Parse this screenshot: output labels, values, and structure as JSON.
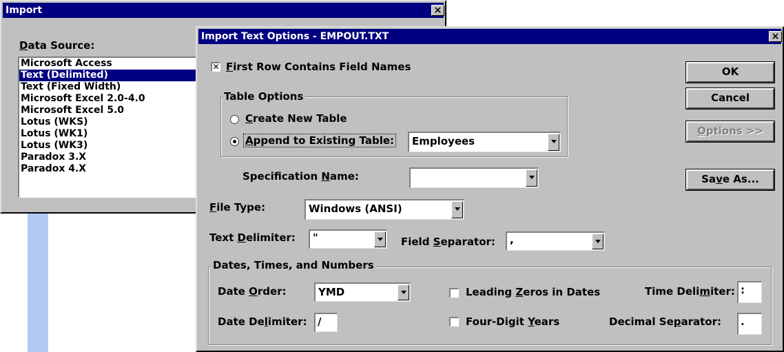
{
  "import_dialog": {
    "title": "Import",
    "close": "×",
    "data_source_label": "Data Source:",
    "sources": [
      "Microsoft Access",
      "Text (Delimited)",
      "Text (Fixed Width)",
      "Microsoft Excel 2.0-4.0",
      "Microsoft Excel 5.0",
      "Lotus (WKS)",
      "Lotus (WK1)",
      "Lotus (WK3)",
      "Paradox 3.X",
      "Paradox 4.X"
    ],
    "selected_index": 1
  },
  "options_dialog": {
    "title": "Import Text Options - EMPOUT.TXT",
    "close": "×",
    "first_row_check": "✕",
    "first_row_label": "First Row Contains Field Names",
    "table_options_title": "Table Options",
    "create_new_label": "Create New Table",
    "append_label": "Append to Existing Table:",
    "append_table_value": "Employees",
    "spec_name_label": "Specification Name:",
    "spec_name_value": "",
    "file_type_label": "File Type:",
    "file_type_value": "Windows (ANSI)",
    "text_delim_label": "Text Delimiter:",
    "text_delim_value": "\"",
    "field_sep_label": "Field Separator:",
    "field_sep_value": ",",
    "dtn_title": "Dates, Times, and Numbers",
    "date_order_label": "Date Order:",
    "date_order_value": "YMD",
    "date_delim_label": "Date Delimiter:",
    "date_delim_value": "/",
    "leading_zeros_label": "Leading Zeros in Dates",
    "four_digit_label": "Four-Digit Years",
    "time_delim_label": "Time Delimiter:",
    "time_delim_value": ":",
    "decimal_sep_label": "Decimal Separator:",
    "decimal_sep_value": ".",
    "buttons": {
      "ok": "OK",
      "cancel": "Cancel",
      "options": "Options >>",
      "save_as": "Save As..."
    }
  }
}
